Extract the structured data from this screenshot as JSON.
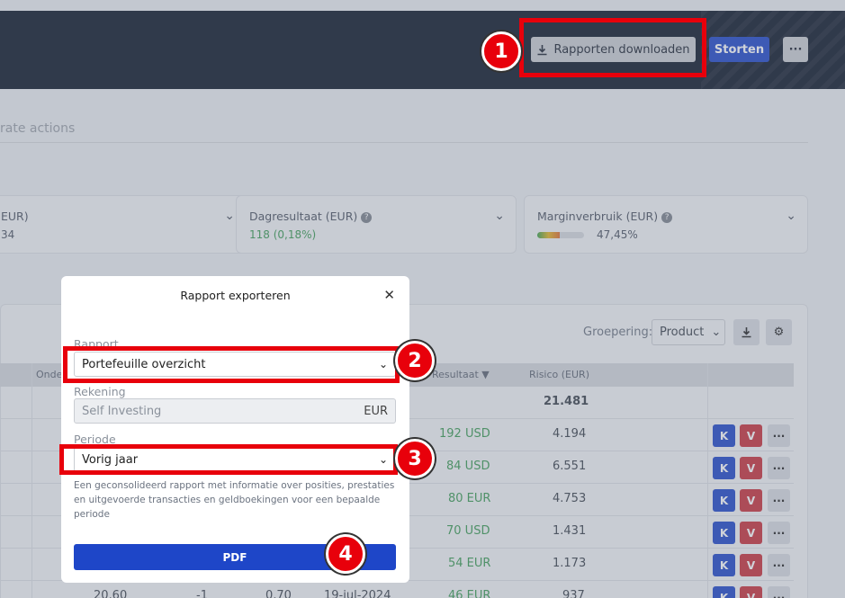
{
  "header": {
    "reports_button": "Rapporten downloaden",
    "deposit_button": "Storten",
    "more_button": "···"
  },
  "tabs": {
    "partial_label": "rate actions"
  },
  "cards": [
    {
      "title": "EUR)",
      "value": "34"
    },
    {
      "title": "Dagresultaat (EUR)",
      "value": "118 (0,18%)"
    },
    {
      "title": "Marginverbruik (EUR)",
      "value": "47,45%",
      "margin_fraction": 0.48
    }
  ],
  "table": {
    "grouping_label": "Groepering:",
    "grouping_value": "Product",
    "headers": {
      "onder": "Onde",
      "resultaat": "Resultaat ▼",
      "risico": "Risico (EUR)"
    },
    "total_risk": "21.481",
    "rows": [
      {
        "result": "192 USD",
        "risk": "4.194"
      },
      {
        "result": "84 USD",
        "risk": "6.551"
      },
      {
        "result": "80 EUR",
        "risk": "4.753"
      },
      {
        "result": "70 USD",
        "risk": "1.431"
      },
      {
        "result": "54 EUR",
        "risk": "1.173"
      },
      {
        "col1": "20,60",
        "col2": "-1",
        "col3": "0,70",
        "date": "19-jul-2024",
        "result": "46 EUR",
        "risk": "937"
      }
    ],
    "action_k": "K",
    "action_v": "V",
    "action_more": "···"
  },
  "modal": {
    "title": "Rapport exporteren",
    "close": "✕",
    "report_label": "Rapport",
    "report_value": "Portefeuille overzicht",
    "account_label": "Rekening",
    "account_value": "Self Investing",
    "account_currency": "EUR",
    "period_label": "Periode",
    "period_value": "Vorig jaar",
    "description": "Een geconsolideerd rapport met informatie over posities, prestaties en uitgevoerde transacties en geldboekingen voor een bepaalde periode",
    "pdf_button": "PDF"
  },
  "annotations": {
    "b1": "1",
    "b2": "2",
    "b3": "3",
    "b4": "4"
  },
  "colors": {
    "highlight": "#e8000b",
    "primary": "#1e46c8",
    "header_bg": "#0a1426"
  }
}
